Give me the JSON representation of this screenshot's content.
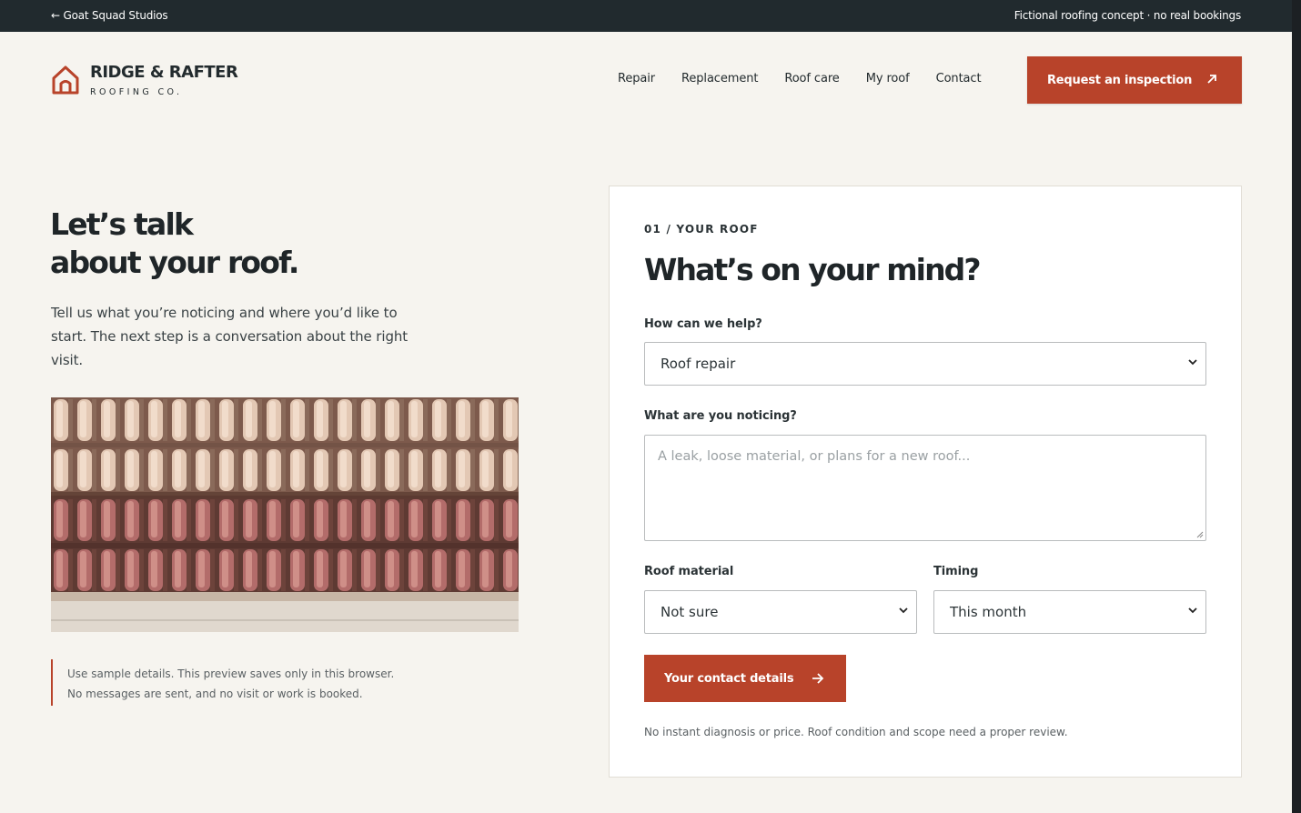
{
  "topbar": {
    "back_label": "← Goat Squad Studios",
    "note": "Fictional roofing concept · no real bookings"
  },
  "brand": {
    "name": "RIDGE & RAFTER",
    "tagline": "ROOFING CO.",
    "accent_color": "#b8432a"
  },
  "nav": {
    "items": [
      "Repair",
      "Replacement",
      "Roof care",
      "My roof",
      "Contact"
    ],
    "cta_label": "Request an inspection"
  },
  "hero": {
    "title_line1": "Let’s talk",
    "title_line2": "about your roof.",
    "text": "Tell us what you’re noticing and where you’d like to start. The next step is a conversation about the right visit.",
    "disclaimer_line1": "Use sample details. This preview saves only in this browser.",
    "disclaimer_line2": "No messages are sent, and no visit or work is booked."
  },
  "form": {
    "step": "01 / YOUR ROOF",
    "title": "What’s on your mind?",
    "help_label": "How can we help?",
    "help_value": "Roof repair",
    "noticing_label": "What are you noticing?",
    "noticing_placeholder": "A leak, loose material, or plans for a new roof...",
    "material_label": "Roof material",
    "material_value": "Not sure",
    "timing_label": "Timing",
    "timing_value": "This month",
    "submit_label": "Your contact details",
    "fine_print": "No instant diagnosis or price. Roof condition and scope need a proper review."
  }
}
